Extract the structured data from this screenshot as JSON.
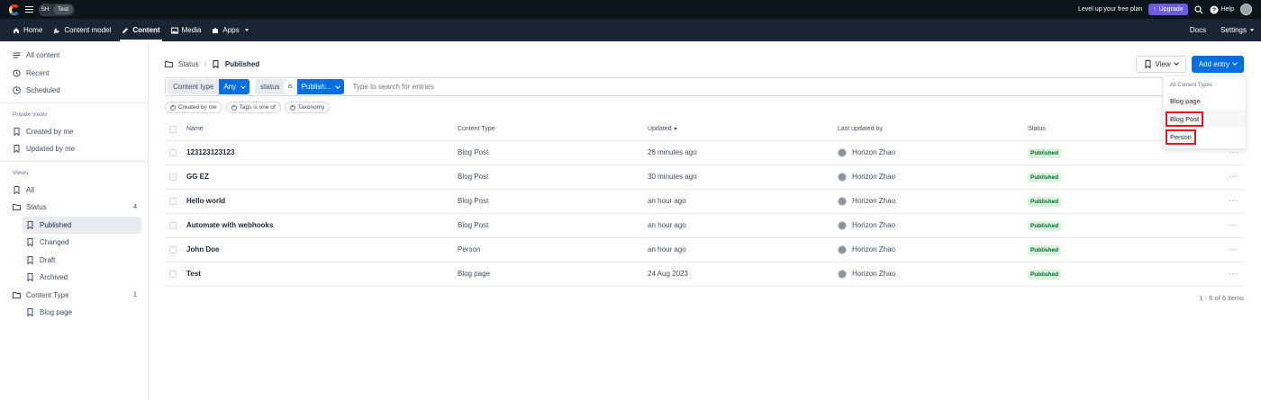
{
  "topbar": {
    "space_initials": "SH",
    "environment": "Test",
    "plan_text": "Level up your free plan",
    "upgrade_label": "Upgrade",
    "help_label": "Help"
  },
  "nav": {
    "items": [
      {
        "label": "Home",
        "icon": "home-icon"
      },
      {
        "label": "Content model",
        "icon": "wrench-icon"
      },
      {
        "label": "Content",
        "icon": "pen-icon",
        "active": true
      },
      {
        "label": "Media",
        "icon": "image-icon"
      },
      {
        "label": "Apps",
        "icon": "puzzle-icon"
      }
    ],
    "docs_label": "Docs",
    "settings_label": "Settings"
  },
  "sidebar": {
    "top": [
      {
        "label": "All content",
        "icon": "list-icon"
      },
      {
        "label": "Recent",
        "icon": "history-icon"
      },
      {
        "label": "Scheduled",
        "icon": "clock-icon"
      }
    ],
    "private_heading": "Private views",
    "private": [
      {
        "label": "Created by me",
        "icon": "bookmark-icon"
      },
      {
        "label": "Updated by me",
        "icon": "bookmark-icon"
      }
    ],
    "views_heading": "Views",
    "views_all": "All",
    "status_folder": {
      "label": "Status",
      "count": "4"
    },
    "status_items": [
      {
        "label": "Published",
        "selected": true
      },
      {
        "label": "Changed"
      },
      {
        "label": "Draft"
      },
      {
        "label": "Archived"
      }
    ],
    "type_folder": {
      "label": "Content Type",
      "count": "1"
    },
    "type_items": [
      {
        "label": "Blog page"
      }
    ]
  },
  "breadcrumb": {
    "parent": "Status",
    "separator": "/",
    "current": "Published"
  },
  "actions": {
    "view_label": "View",
    "add_label": "Add entry"
  },
  "filters": {
    "content_type_key": "Content type",
    "content_type_value": "Any",
    "status_key": "status",
    "status_op": "is",
    "status_value": "Publish...",
    "search_placeholder": "Type to search for entries"
  },
  "chips": [
    "Created by me",
    "Tags is one of",
    "Taxonomy"
  ],
  "table": {
    "headers": {
      "name": "Name",
      "type": "Content Type",
      "updated": "Updated",
      "user": "Last updated by",
      "status": "Status"
    },
    "rows": [
      {
        "name": "123123123123",
        "type": "Blog Post",
        "updated": "26 minutes ago",
        "user": "Horizon Zhao",
        "status": "Published"
      },
      {
        "name": "GG EZ",
        "type": "Blog Post",
        "updated": "30 minutes ago",
        "user": "Horizon Zhao",
        "status": "Published"
      },
      {
        "name": "Hello world",
        "type": "Blog Post",
        "updated": "an hour ago",
        "user": "Horizon Zhao",
        "status": "Published"
      },
      {
        "name": "Automate with webhooks",
        "type": "Blog Post",
        "updated": "an hour ago",
        "user": "Horizon Zhao",
        "status": "Published"
      },
      {
        "name": "John Doe",
        "type": "Person",
        "updated": "an hour ago",
        "user": "Horizon Zhao",
        "status": "Published"
      },
      {
        "name": "Test",
        "type": "Blog page",
        "updated": "24 Aug 2023",
        "user": "Horizon Zhao",
        "status": "Published"
      }
    ],
    "more_glyph": "···"
  },
  "pager": "1 - 6 of 6 items",
  "dropdown": {
    "heading": "All Content Types",
    "items": [
      "Blog page",
      "Blog Post",
      "Person"
    ]
  },
  "colors": {
    "primary": "#036fe3",
    "topbar": "#0c141c",
    "navbar": "#192532",
    "badge_bg": "#d9f3de",
    "badge_fg": "#006b2b",
    "upgrade": "#6c5ae6",
    "highlight": "#e3161f"
  }
}
